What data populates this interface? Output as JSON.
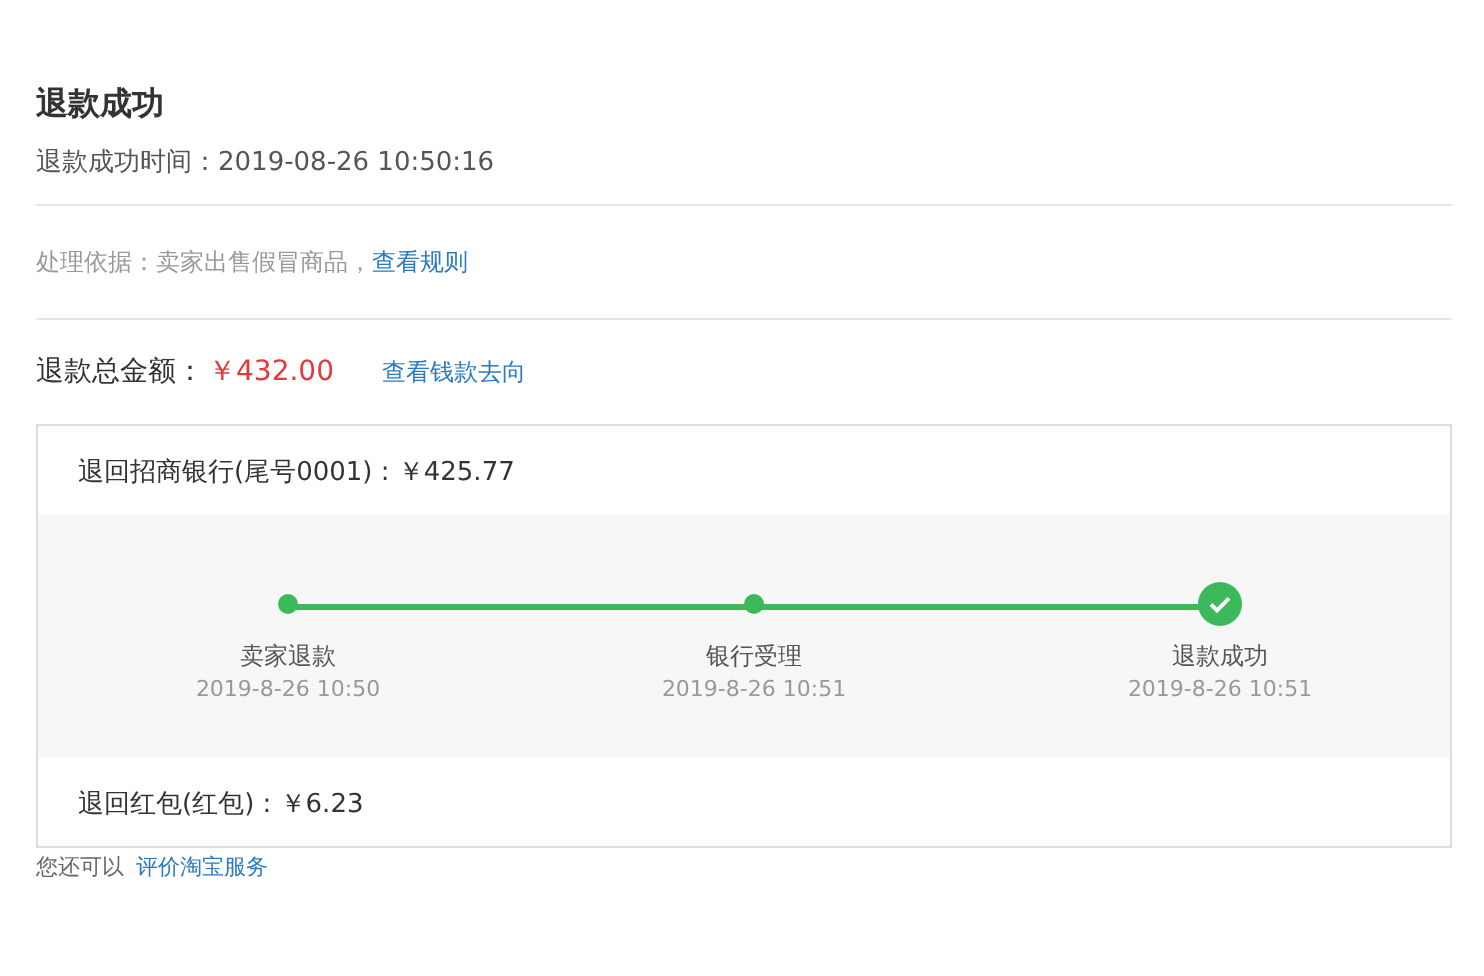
{
  "title": "退款成功",
  "success_time": {
    "label": "退款成功时间：",
    "value": "2019-08-26 10:50:16"
  },
  "basis": {
    "label": "处理依据：卖家出售假冒商品，",
    "link": "查看规则"
  },
  "total": {
    "label": "退款总金额：",
    "amount": "￥432.00",
    "link": "查看钱款去向"
  },
  "refunds": [
    {
      "text": "退回招商银行(尾号0001) : ￥425.77",
      "steps": [
        {
          "kind": "point",
          "label": "卖家退款",
          "time": "2019-8-26 10:50"
        },
        {
          "kind": "point",
          "label": "银行受理",
          "time": "2019-8-26 10:51"
        },
        {
          "kind": "check",
          "label": "退款成功",
          "time": "2019-8-26 10:51"
        }
      ]
    },
    {
      "text": "退回红包(红包) : ￥6.23"
    }
  ],
  "footer": {
    "text": "您还可以",
    "link": "评价淘宝服务"
  }
}
